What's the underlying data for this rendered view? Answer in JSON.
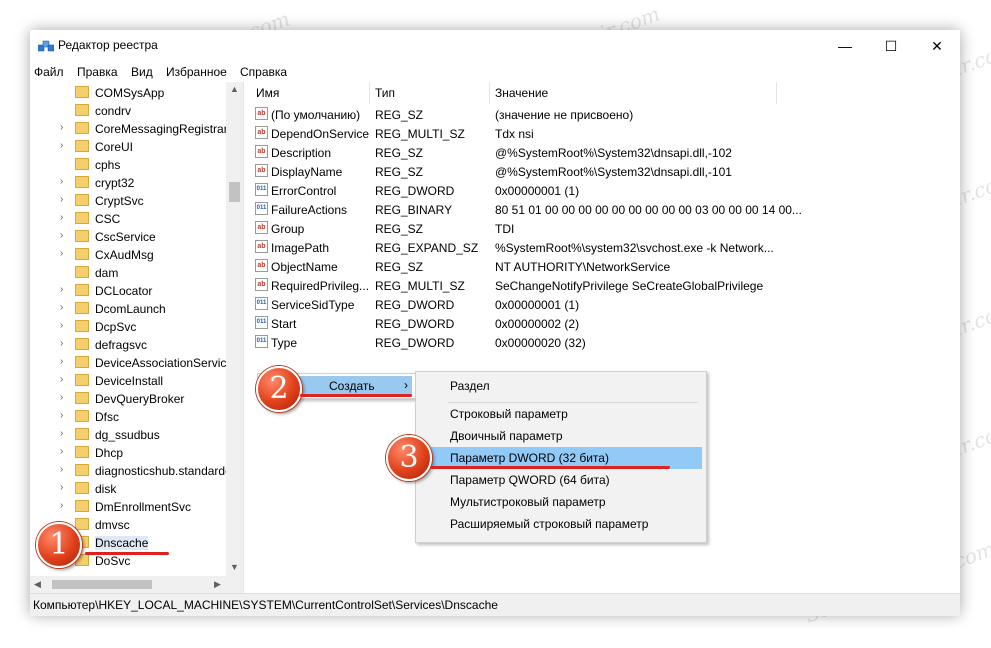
{
  "window": {
    "title": "Редактор реестра",
    "controls": {
      "minimize": "—",
      "maximize": "☐",
      "close": "✕"
    }
  },
  "menu": [
    "Файл",
    "Правка",
    "Вид",
    "Избранное",
    "Справка"
  ],
  "tree": {
    "items": [
      {
        "label": "COMSysApp",
        "expandable": false
      },
      {
        "label": "condrv",
        "expandable": false
      },
      {
        "label": "CoreMessagingRegistrar",
        "expandable": true
      },
      {
        "label": "CoreUI",
        "expandable": true
      },
      {
        "label": "cphs",
        "expandable": false
      },
      {
        "label": "crypt32",
        "expandable": true
      },
      {
        "label": "CryptSvc",
        "expandable": true
      },
      {
        "label": "CSC",
        "expandable": true
      },
      {
        "label": "CscService",
        "expandable": true
      },
      {
        "label": "CxAudMsg",
        "expandable": true
      },
      {
        "label": "dam",
        "expandable": false
      },
      {
        "label": "DCLocator",
        "expandable": true
      },
      {
        "label": "DcomLaunch",
        "expandable": true
      },
      {
        "label": "DcpSvc",
        "expandable": true
      },
      {
        "label": "defragsvc",
        "expandable": true
      },
      {
        "label": "DeviceAssociationService",
        "expandable": true
      },
      {
        "label": "DeviceInstall",
        "expandable": true
      },
      {
        "label": "DevQueryBroker",
        "expandable": true
      },
      {
        "label": "Dfsc",
        "expandable": true
      },
      {
        "label": "dg_ssudbus",
        "expandable": true
      },
      {
        "label": "Dhcp",
        "expandable": true
      },
      {
        "label": "diagnosticshub.standardcollector",
        "expandable": true
      },
      {
        "label": "disk",
        "expandable": true
      },
      {
        "label": "DmEnrollmentSvc",
        "expandable": true
      },
      {
        "label": "dmvsc",
        "expandable": true
      },
      {
        "label": "Dnscache",
        "expandable": true,
        "selected": true
      },
      {
        "label": "DoSvc",
        "expandable": true
      }
    ]
  },
  "values": {
    "columns": {
      "name": "Имя",
      "type": "Тип",
      "data": "Значение"
    },
    "rows": [
      {
        "icon": "ab",
        "name": "(По умолчанию)",
        "type": "REG_SZ",
        "data": "(значение не присвоено)"
      },
      {
        "icon": "ab",
        "name": "DependOnService",
        "type": "REG_MULTI_SZ",
        "data": "Tdx nsi"
      },
      {
        "icon": "ab",
        "name": "Description",
        "type": "REG_SZ",
        "data": "@%SystemRoot%\\System32\\dnsapi.dll,-102"
      },
      {
        "icon": "ab",
        "name": "DisplayName",
        "type": "REG_SZ",
        "data": "@%SystemRoot%\\System32\\dnsapi.dll,-101"
      },
      {
        "icon": "bin",
        "name": "ErrorControl",
        "type": "REG_DWORD",
        "data": "0x00000001 (1)"
      },
      {
        "icon": "bin",
        "name": "FailureActions",
        "type": "REG_BINARY",
        "data": "80 51 01 00 00 00 00 00 00 00 00 00 03 00 00 00 14 00..."
      },
      {
        "icon": "ab",
        "name": "Group",
        "type": "REG_SZ",
        "data": "TDI"
      },
      {
        "icon": "ab",
        "name": "ImagePath",
        "type": "REG_EXPAND_SZ",
        "data": "%SystemRoot%\\system32\\svchost.exe -k Network..."
      },
      {
        "icon": "ab",
        "name": "ObjectName",
        "type": "REG_SZ",
        "data": "NT AUTHORITY\\NetworkService"
      },
      {
        "icon": "ab",
        "name": "RequiredPrivileg...",
        "type": "REG_MULTI_SZ",
        "data": "SeChangeNotifyPrivilege SeCreateGlobalPrivilege"
      },
      {
        "icon": "bin",
        "name": "ServiceSidType",
        "type": "REG_DWORD",
        "data": "0x00000001 (1)"
      },
      {
        "icon": "bin",
        "name": "Start",
        "type": "REG_DWORD",
        "data": "0x00000002 (2)"
      },
      {
        "icon": "bin",
        "name": "Type",
        "type": "REG_DWORD",
        "data": "0x00000020 (32)"
      }
    ]
  },
  "context_menu": {
    "create_label": "Создать",
    "submenu": [
      {
        "label": "Раздел"
      },
      {
        "label": "Строковый параметр"
      },
      {
        "label": "Двоичный параметр"
      },
      {
        "label": "Параметр DWORD (32 бита)",
        "selected": true
      },
      {
        "label": "Параметр QWORD (64 бита)"
      },
      {
        "label": "Мультистроковый параметр"
      },
      {
        "label": "Расширяемый строковый параметр"
      }
    ]
  },
  "status_path": "Компьютер\\HKEY_LOCAL_MACHINE\\SYSTEM\\CurrentControlSet\\Services\\Dnscache",
  "badges": [
    "1",
    "2",
    "3"
  ],
  "watermark": "Soringpcrepair.com",
  "colors": {
    "highlight": "#91c9f7",
    "badge": "#e0401a",
    "underline": "#e02121"
  }
}
